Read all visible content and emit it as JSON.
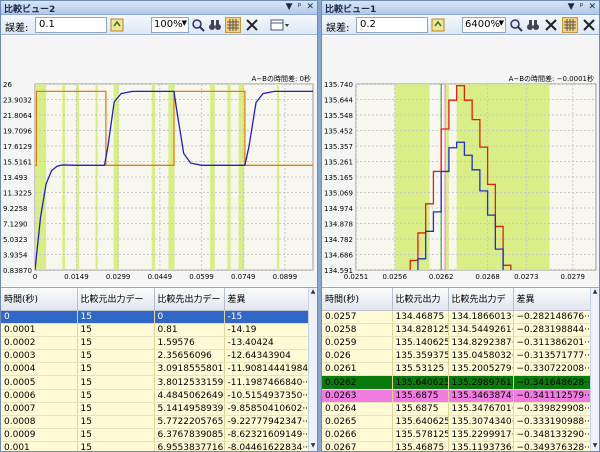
{
  "left": {
    "title": "比較ビュー2",
    "title_buttons": [
      "▼",
      "ᵖ",
      "✕"
    ],
    "tolerance_label": "誤差:",
    "tolerance_value": "0.1",
    "zoom_value": "100%",
    "chart_data": {
      "type": "line",
      "annotation": "A−Bの時間差: 0秒",
      "y_ticks": [
        "26",
        "23.9032",
        "21.8064",
        "19.7096",
        "17.6129",
        "15.5161",
        "13.493",
        "11.3225",
        "9.2258",
        "7.1290",
        "5.0323",
        "3.9354",
        "0.83870"
      ],
      "x_ticks": [
        "0",
        "0.0149",
        "0.0299",
        "0.0449",
        "0.0599",
        "0.0749",
        "0.0899"
      ],
      "ylim": [
        0.8387,
        26
      ],
      "xlim": [
        0,
        0.1
      ],
      "grid": true,
      "highlight_bands": [
        [
          0,
          0.004
        ],
        [
          0.0098,
          0.0108
        ],
        [
          0.0148,
          0.0158
        ],
        [
          0.0218,
          0.0226
        ],
        [
          0.0283,
          0.0302
        ],
        [
          0.042,
          0.0432
        ],
        [
          0.048,
          0.0502
        ],
        [
          0.063,
          0.0647
        ],
        [
          0.0692,
          0.0704
        ],
        [
          0.0732,
          0.0753
        ],
        [
          0.087,
          0.0878
        ]
      ],
      "series": [
        {
          "color": "#e08010",
          "x": [
            0,
            0.0005,
            0.0005,
            0.0255,
            0.0255,
            0.05,
            0.05,
            0.0755,
            0.0755,
            0.1
          ],
          "y": [
            15,
            15,
            25,
            25,
            15,
            15,
            25,
            25,
            15,
            15
          ]
        },
        {
          "color": "#2020c0",
          "x": [
            0,
            0.002,
            0.004,
            0.006,
            0.008,
            0.01,
            0.015,
            0.025,
            0.0262,
            0.0285,
            0.031,
            0.035,
            0.04,
            0.05,
            0.051,
            0.0535,
            0.056,
            0.06,
            0.0755,
            0.077,
            0.0795,
            0.082,
            0.086,
            0.1
          ],
          "y": [
            0.84,
            8,
            12.5,
            14.3,
            14.9,
            15.05,
            15,
            15,
            17.5,
            23.6,
            24.7,
            25,
            25,
            25,
            22.4,
            16.6,
            15.3,
            15,
            15,
            17.6,
            23.5,
            24.7,
            25,
            25
          ]
        }
      ]
    },
    "table": {
      "columns": [
        "時間(秒)",
        "比較元出力デー",
        "比較先出力デー",
        "差異"
      ],
      "rows": [
        [
          "0",
          "15",
          "0",
          "-15"
        ],
        [
          "0.0001",
          "15",
          "0.81",
          "-14.19"
        ],
        [
          "0.0002",
          "15",
          "1.59576",
          "-13.40424"
        ],
        [
          "0.0003",
          "15",
          "2.35656096",
          "-12.64343904"
        ],
        [
          "0.0004",
          "15",
          "3.09185558016",
          "-11.90814441984"
        ],
        [
          "0.0005",
          "15",
          "3.8012533159···",
          "-11.1987466840···"
        ],
        [
          "0.0006",
          "15",
          "4.4845062649···",
          "-10.5154937350···"
        ],
        [
          "0.0007",
          "15",
          "5.1414958939···",
          "-9.85850410602···"
        ],
        [
          "0.0008",
          "15",
          "5.7722205765···",
          "-9.22777942347···"
        ],
        [
          "0.0009",
          "15",
          "6.3767839085···",
          "-8.62321609149···"
        ],
        [
          "0.001",
          "15",
          "6.9553837716···",
          "-8.04461622834···"
        ]
      ]
    }
  },
  "right": {
    "title": "比較ビュー1",
    "title_buttons": [
      "▼",
      "ᵖ",
      "✕"
    ],
    "tolerance_label": "誤差:",
    "tolerance_value": "0.2",
    "zoom_value": "6400%",
    "chart_data": {
      "type": "line",
      "annotation": "A−Bの時間差: −0.0001秒",
      "y_ticks": [
        "135.740",
        "135.644",
        "135.548",
        "135.452",
        "135.357",
        "135.261",
        "135.165",
        "135.069",
        "134.974",
        "134.878",
        "134.782",
        "134.686",
        "134.591"
      ],
      "x_ticks": [
        "0.0251",
        "0.0256",
        "0.0262",
        "0.0268",
        "0.0273",
        "0.0279"
      ],
      "ylim": [
        134.591,
        135.74
      ],
      "xlim": [
        0.0251,
        0.0282
      ],
      "grid": true,
      "highlight_bands": [
        [
          0.0256,
          0.02605
        ],
        [
          0.02625,
          0.0263
        ],
        [
          0.0264,
          0.0276
        ]
      ],
      "markers": [
        {
          "x": 0.0262,
          "color": "#10a010"
        },
        {
          "x": 0.02625,
          "color": "#f07ce0"
        }
      ],
      "series": [
        {
          "color": "#e02010",
          "x": [
            0.0257,
            0.0258,
            0.0259,
            0.026,
            0.0261,
            0.0262,
            0.0263,
            0.0264,
            0.0265,
            0.0266,
            0.0267,
            0.0268,
            0.0269,
            0.027,
            0.0271
          ],
          "y": [
            134.5,
            134.65,
            134.82,
            135.0,
            135.2,
            135.462,
            135.64,
            135.73,
            135.64,
            135.52,
            135.35,
            135.12,
            134.86,
            134.62,
            134.5
          ]
        },
        {
          "color": "#2030c0",
          "x": [
            0.0258,
            0.0259,
            0.026,
            0.0261,
            0.0262,
            0.0263,
            0.0264,
            0.0265,
            0.0266,
            0.0267,
            0.0268,
            0.0269,
            0.027
          ],
          "y": [
            134.5,
            134.66,
            134.83,
            134.95,
            135.2,
            135.346,
            135.38,
            135.3,
            135.21,
            135.08,
            134.93,
            134.72,
            134.5
          ]
        }
      ]
    },
    "table": {
      "columns": [
        "時間(秒)",
        "比較元出力",
        "比較先出力デ",
        "差異"
      ],
      "rows": [
        [
          "0.0257",
          "134.46875",
          "134.1866013···",
          "−0.282148676···"
        ],
        [
          "0.0258",
          "134.828125",
          "134.5449261···",
          "−0.283198844···"
        ],
        [
          "0.0259",
          "135.140625",
          "134.8292387···",
          "−0.311386201···"
        ],
        [
          "0.026",
          "135.359375",
          "135.0458032···",
          "−0.313571777···"
        ],
        [
          "0.0261",
          "135.53125",
          "135.2005279···",
          "−0.330722008···"
        ],
        [
          "0.0262",
          "135.640625",
          "135.2989761···",
          "−0.341648628···"
        ],
        [
          "0.0263",
          "135.6875",
          "135.3463874···",
          "−0.341112579···"
        ],
        [
          "0.0264",
          "135.6875",
          "135.3476701···",
          "−0.339829908···"
        ],
        [
          "0.0265",
          "135.640625",
          "135.3074340···",
          "−0.333190988···"
        ],
        [
          "0.0266",
          "135.578125",
          "135.2299917···",
          "−0.348133290···"
        ],
        [
          "0.0267",
          "135.46875",
          "135.1193736···",
          "−0.349376328···"
        ]
      ]
    }
  }
}
